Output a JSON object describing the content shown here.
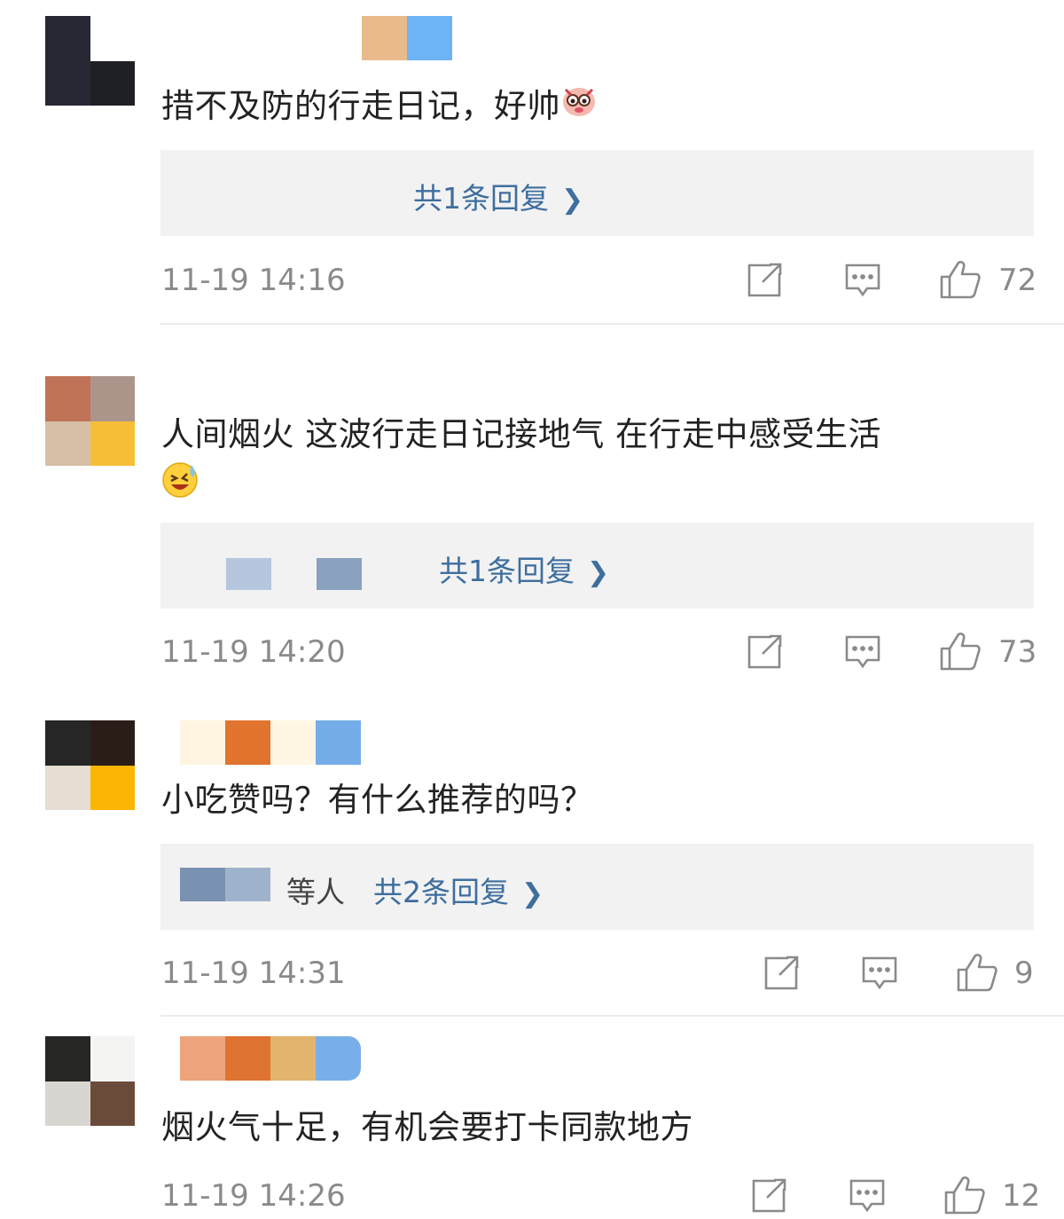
{
  "comments": [
    {
      "text": "措不及防的行走日记，好帅",
      "emoji": "emoji-pig-face",
      "replies_link": "共1条回复",
      "time": "11-19 14:16",
      "likes": "72"
    },
    {
      "text": "人间烟火 这波行走日记接地气 在行走中感受生活",
      "emoji": "emoji-laugh-cry",
      "replies_link": "共1条回复",
      "time": "11-19 14:20",
      "likes": "73"
    },
    {
      "text": "小吃赞吗？有什么推荐的吗？",
      "replies_prefix": "等人",
      "replies_link": "共2条回复",
      "time": "11-19 14:31",
      "likes": "9"
    },
    {
      "text": "烟火气十足，有机会要打卡同款地方",
      "time": "11-19 14:26",
      "likes": "12"
    }
  ],
  "colors": {
    "link": "#3e6e9e",
    "meta": "#8a8a8a",
    "reply_bg": "#f2f2f2"
  }
}
